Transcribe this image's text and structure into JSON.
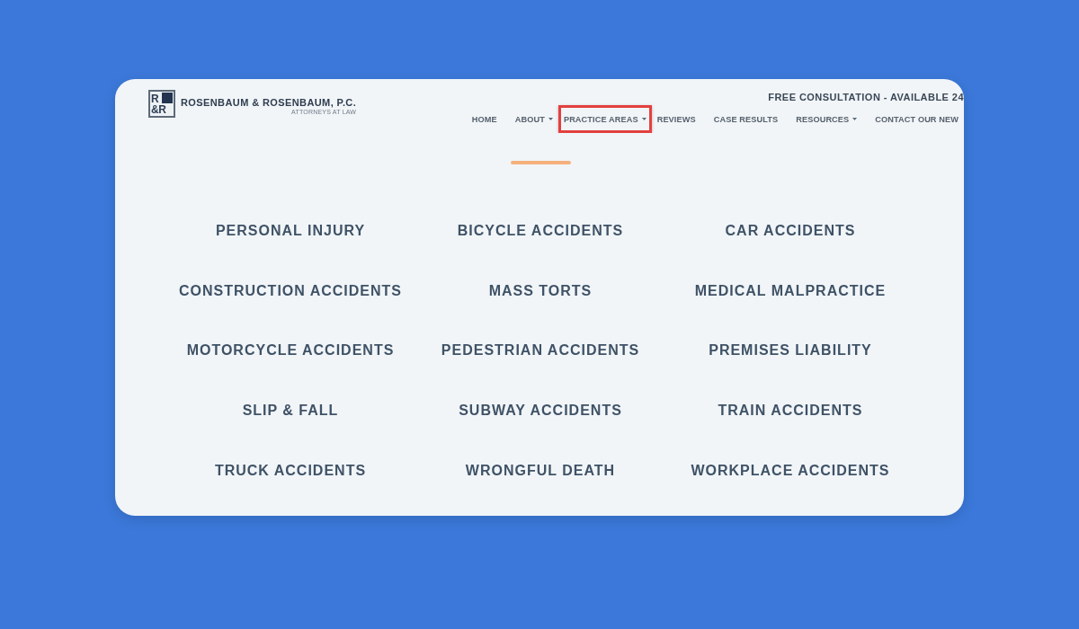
{
  "logo": {
    "mark_top": "R",
    "mark_bottom": "&R",
    "name": "ROSENBAUM & ROSENBAUM, P.C.",
    "tagline": "ATTORNEYS AT LAW"
  },
  "top_bar": {
    "text": "FREE CONSULTATION - AVAILABLE 24"
  },
  "nav": [
    {
      "label": "HOME",
      "dropdown": false,
      "highlighted": false
    },
    {
      "label": "ABOUT",
      "dropdown": true,
      "highlighted": false
    },
    {
      "label": "PRACTICE AREAS",
      "dropdown": true,
      "highlighted": true
    },
    {
      "label": "REVIEWS",
      "dropdown": false,
      "highlighted": false
    },
    {
      "label": "CASE RESULTS",
      "dropdown": false,
      "highlighted": false
    },
    {
      "label": "RESOURCES",
      "dropdown": true,
      "highlighted": false
    },
    {
      "label": "CONTACT OUR NEW",
      "dropdown": false,
      "highlighted": false
    }
  ],
  "practice_areas": [
    "PERSONAL INJURY",
    "BICYCLE ACCIDENTS",
    "CAR ACCIDENTS",
    "CONSTRUCTION ACCIDENTS",
    "MASS TORTS",
    "MEDICAL MALPRACTICE",
    "MOTORCYCLE ACCIDENTS",
    "PEDESTRIAN ACCIDENTS",
    "PREMISES LIABILITY",
    "SLIP & FALL",
    "SUBWAY ACCIDENTS",
    "TRAIN ACCIDENTS",
    "TRUCK ACCIDENTS",
    "WRONGFUL DEATH",
    "WORKPLACE ACCIDENTS"
  ]
}
